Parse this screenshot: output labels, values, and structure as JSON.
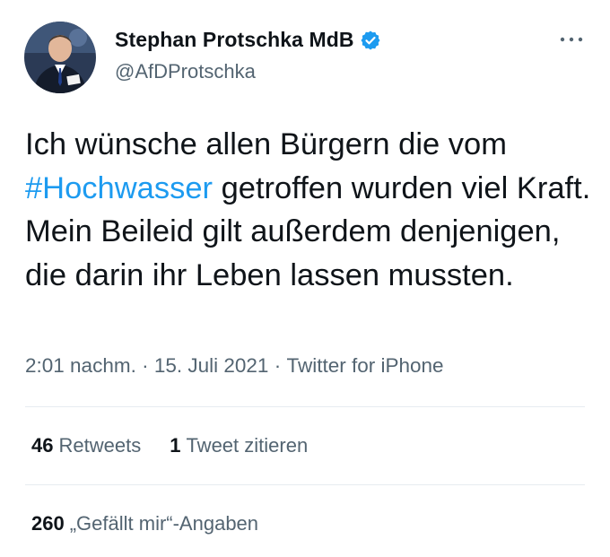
{
  "author": {
    "display_name": "Stephan Protschka MdB",
    "handle": "@AfDProtschka",
    "verified": true,
    "verified_color": "#1d9bf0"
  },
  "tweet": {
    "text_before": "Ich wünsche allen Bürgern die vom ",
    "hashtag": "#Hochwasser",
    "text_after": " getroffen wurden viel Kraft. Mein Beileid gilt außerdem denjenigen, die darin ihr Leben lassen mussten.",
    "hashtag_color": "#1d9bf0"
  },
  "meta": {
    "time": "2:01 nachm.",
    "separator": " · ",
    "date": "15. Juli 2021",
    "source": "Twitter for iPhone"
  },
  "stats": {
    "retweets_count": "46",
    "retweets_label": "Retweets",
    "quotes_count": "1",
    "quotes_label": "Tweet zitieren",
    "likes_count": "260",
    "likes_label": "„Gefällt mir“-Angaben"
  },
  "icons": {
    "more": "more-horizontal-icon",
    "verified": "verified-badge-icon"
  }
}
